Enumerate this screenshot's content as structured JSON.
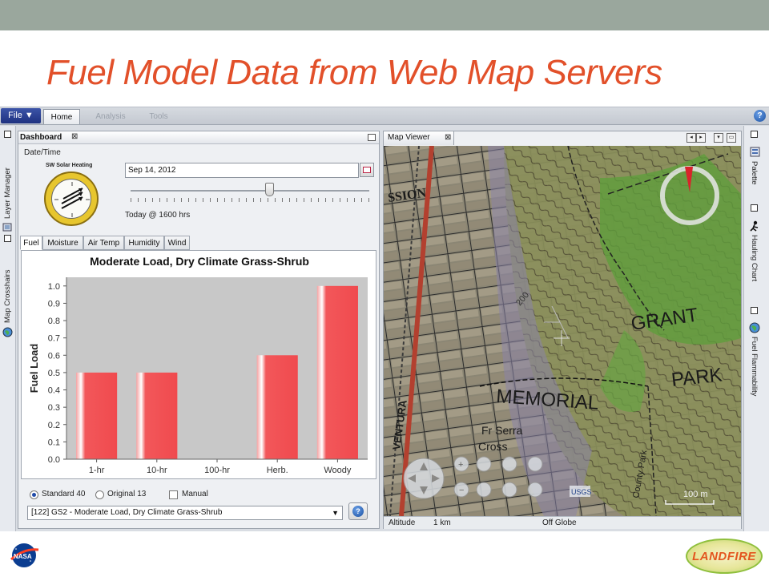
{
  "slide": {
    "title": "Fuel Model Data from Web Map Servers"
  },
  "menubar": {
    "file": "File ▼",
    "tabs": [
      {
        "label": "Home"
      },
      {
        "label": "Analysis"
      },
      {
        "label": "Tools"
      }
    ],
    "help": "?"
  },
  "left_sidebar": {
    "items": [
      {
        "label": "Layer Manager",
        "icon": "layers-icon"
      },
      {
        "label": "Map Crosshairs",
        "icon": "globe-icon"
      }
    ]
  },
  "right_sidebar": {
    "items": [
      {
        "label": "Palette",
        "icon": "palette-icon"
      },
      {
        "label": "Hauling Chart",
        "icon": "hauling-icon"
      },
      {
        "label": "Fuel Flammability",
        "icon": "globe-icon"
      }
    ]
  },
  "dashboard": {
    "title": "Dashboard",
    "close": "⊠",
    "datetime_label": "Date/Time",
    "solar_label": "SW Solar Heating",
    "date_value": "Sep 14, 2012",
    "slider_value": 0.58,
    "today_text": "Today @ 1600 hrs",
    "tabs": [
      {
        "label": "Fuel"
      },
      {
        "label": "Moisture"
      },
      {
        "label": "Air Temp"
      },
      {
        "label": "Humidity"
      },
      {
        "label": "Wind"
      }
    ],
    "radio_standard": "Standard 40",
    "radio_original": "Original 13",
    "manual": "Manual",
    "fuel_model_select": "[122] GS2 - Moderate Load, Dry Climate Grass-Shrub",
    "info": "?"
  },
  "chart_data": {
    "type": "bar",
    "title": "Moderate Load, Dry Climate Grass-Shrub",
    "xlabel": "",
    "ylabel": "Fuel Load",
    "categories": [
      "1-hr",
      "10-hr",
      "100-hr",
      "Herb.",
      "Woody"
    ],
    "values": [
      0.5,
      0.5,
      0,
      0.6,
      1.0
    ],
    "ylim": [
      0,
      1.05
    ],
    "yticks": [
      "0.0",
      "0.1",
      "0.2",
      "0.3",
      "0.4",
      "0.5",
      "0.6",
      "0.7",
      "0.8",
      "0.9",
      "1.0"
    ],
    "grid": false,
    "bar_color": "#f2575a"
  },
  "map_viewer": {
    "title": "Map Viewer",
    "close": "⊠",
    "labels": {
      "grant": "GRANT",
      "park": "PARK",
      "memorial": "MEMORIAL",
      "fr_serra": "Fr Serra",
      "cross": "Cross",
      "ssion": "SSION",
      "ventura": "VENTURA",
      "county_park": "County Park",
      "usgs": "USGS",
      "contour_200": "200",
      "scale": "100 m"
    },
    "status": {
      "altitude_label": "Altitude",
      "altitude_value": "1 km",
      "globe": "Off Globe"
    }
  },
  "logos": {
    "nasa": "NASA",
    "landfire": "LANDFIRE"
  }
}
